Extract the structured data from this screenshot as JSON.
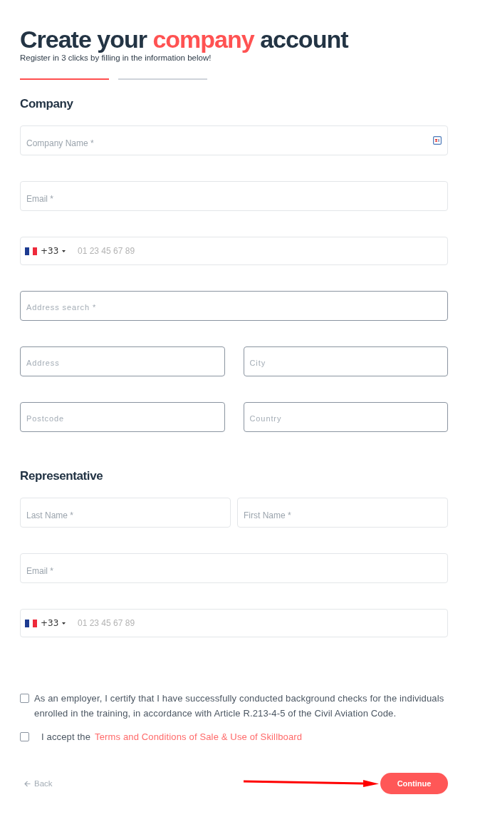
{
  "header": {
    "title": [
      {
        "text": "Create your",
        "highlight": false
      },
      {
        "text": "company",
        "highlight": true
      },
      {
        "text": "account",
        "highlight": false
      }
    ],
    "subtitle": "Register in 3 clicks by filling in the information below!"
  },
  "steps": [
    {
      "selected": true
    },
    {
      "selected": false
    }
  ],
  "sections": [
    {
      "title": "Company",
      "rows": [
        [
          {
            "kind": "text",
            "placeholder": "Company Name *",
            "icon": true
          }
        ],
        [
          {
            "kind": "text",
            "placeholder": "Email *",
            "icon": false
          }
        ],
        [
          {
            "kind": "phone",
            "dial_code": "+33",
            "placeholder": "01 23 45 67 89"
          }
        ],
        [
          {
            "kind": "outlined",
            "placeholder": "Address search *"
          }
        ],
        [
          {
            "kind": "outlined",
            "placeholder": "Address"
          },
          {
            "kind": "outlined",
            "placeholder": "City"
          }
        ],
        [
          {
            "kind": "outlined",
            "placeholder": "Postcode"
          },
          {
            "kind": "outlined",
            "placeholder": "Country"
          }
        ]
      ]
    },
    {
      "title": "Representative",
      "rows": [
        [
          {
            "kind": "text",
            "placeholder": "Last Name *",
            "icon": false
          },
          {
            "kind": "text",
            "placeholder": "First Name *",
            "icon": false
          }
        ],
        [
          {
            "kind": "text",
            "placeholder": "Email *",
            "icon": false
          }
        ],
        [
          {
            "kind": "phone",
            "dial_code": "+33",
            "placeholder": "01 23 45 67 89"
          }
        ]
      ]
    }
  ],
  "agreements": [
    {
      "text": "As an employer, I certify that I have successfully conducted background checks for the individuals enrolled in the training, in accordance with Article R.213-4-5 of the Civil Aviation Code.",
      "checked": false
    },
    {
      "text": "I accept the",
      "link": "Terms and Conditions of Sale & Use of Skillboard",
      "checked": false
    }
  ],
  "footer": {
    "back": "Back",
    "continue": "Continue"
  }
}
